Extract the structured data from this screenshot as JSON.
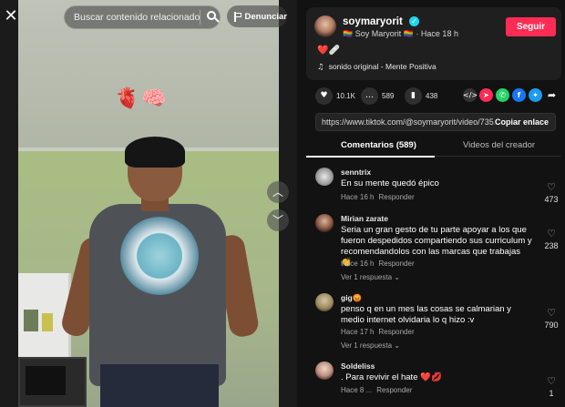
{
  "search": {
    "placeholder_text": "Buscar contenido relacionado"
  },
  "report": {
    "label": "Denunciar"
  },
  "overlay": {
    "emojis": [
      "🫀",
      "🧠"
    ]
  },
  "author": {
    "name": "soymaryorit",
    "subtitle": "🏳️‍🌈 Soy Maryorit 🏳️‍🌈 · Hace 18 h",
    "follow_label": "Seguir",
    "caption": "❤️🩹",
    "music": "sonido original - Mente Positiva"
  },
  "actions": {
    "likes": "10.1K",
    "comments": "589",
    "saves": "438"
  },
  "link": {
    "url": "https://www.tiktok.com/@soymaryorit/video/735...",
    "copy_label": "Copiar enlace"
  },
  "tabs": {
    "comments": "Comentarios (589)",
    "videos": "Videos del creador"
  },
  "comments": [
    {
      "user": "senntrix",
      "text": "En su mente quedó épico",
      "time": "Hace 16 h",
      "reply": "Responder",
      "likes": "473",
      "more": ""
    },
    {
      "user": "Mirian zarate",
      "text": "Seria un gran gesto de tu parte apoyar a los que fueron despedidos compartiendo sus curriculum y recomendandolos con las marcas que trabajas 👏",
      "time": "Hace 16 h",
      "reply": "Responder",
      "likes": "238",
      "more": "Ver 1 respuesta ⌄"
    },
    {
      "user": "gig😡",
      "text": "penso q en un mes las cosas se calmarian y medio internet olvidaria lo q hizo :v",
      "time": "Hace 17 h",
      "reply": "Responder",
      "likes": "790",
      "more": "Ver 1 respuesta ⌄"
    },
    {
      "user": "Soldeliss",
      "text": ". Para revivir el hate ❤️💋",
      "time": "Hace 8 ...",
      "reply": "Responder",
      "likes": "1",
      "more": ""
    }
  ],
  "colors": {
    "accent": "#fe2c55",
    "verified": "#20d5ec",
    "panel_bg": "#121212"
  }
}
